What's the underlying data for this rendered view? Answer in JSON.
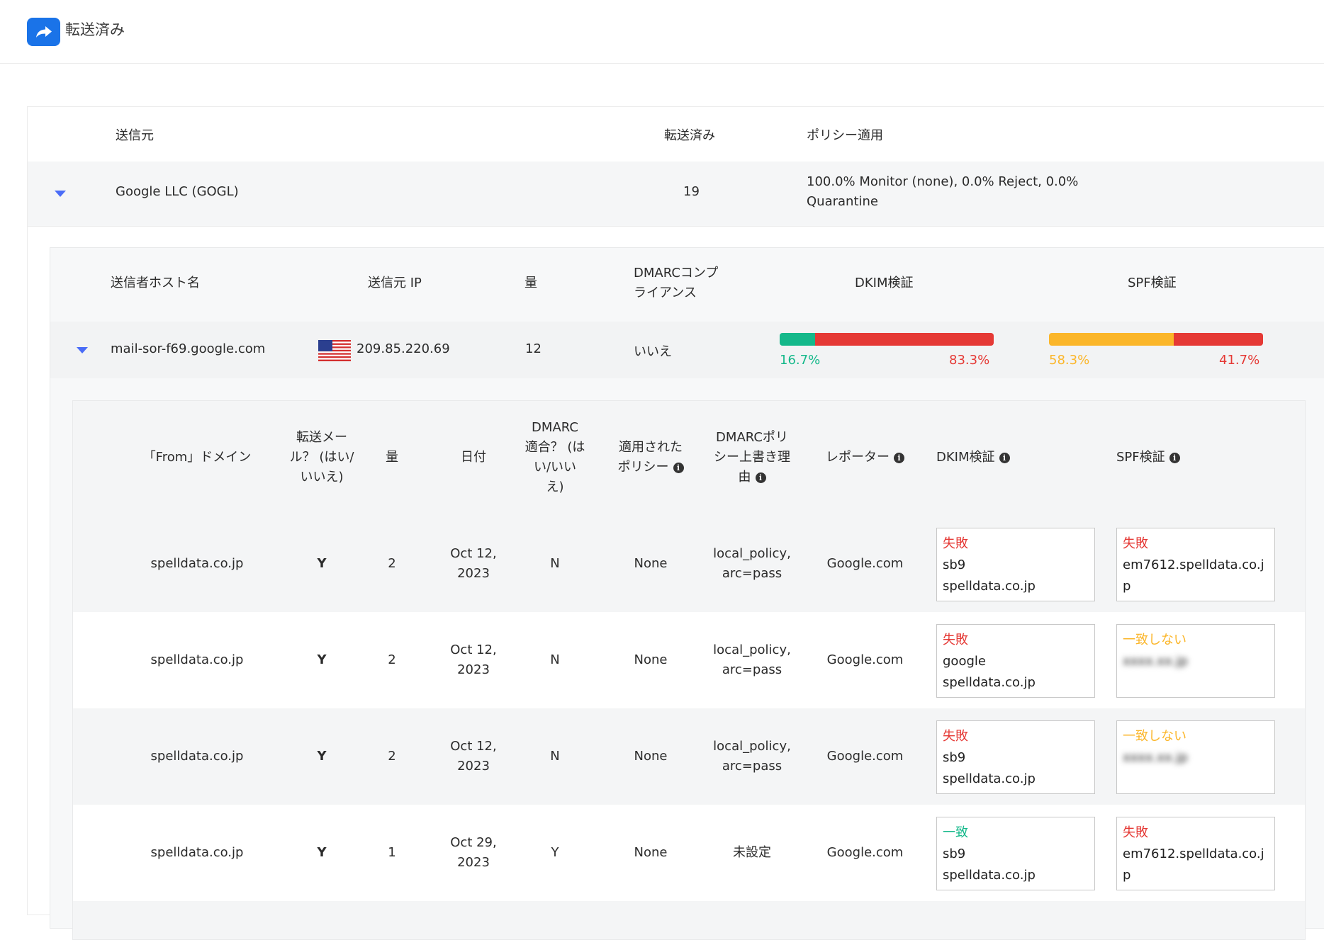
{
  "header": {
    "title": "転送済み",
    "icon": "forward-arrow-icon",
    "accent": "#1a73e8"
  },
  "table1": {
    "columns": {
      "source": "送信元",
      "forwarded": "転送済み",
      "policy": "ポリシー適用"
    },
    "row": {
      "source": "Google LLC (GOGL)",
      "forwarded": "19",
      "policy_line1": "100.0% Monitor (none), 0.0% Reject, 0.0%",
      "policy_line2": "Quarantine"
    }
  },
  "table2": {
    "columns": {
      "host": "送信者ホスト名",
      "ip": "送信元 IP",
      "volume": "量",
      "dmarc_line1": "DMARCコンプ",
      "dmarc_line2": "ライアンス",
      "dkim": "DKIM検証",
      "spf": "SPF検証"
    },
    "row": {
      "host": "mail-sor-f69.google.com",
      "ip": "209.85.220.69",
      "flag": "us-flag-icon",
      "volume": "12",
      "dmarc": "いいえ",
      "dkim": {
        "pass_pct": 16.7,
        "fail_pct": 83.3,
        "pass_label": "16.7%",
        "fail_label": "83.3%",
        "pass_color": "#14b88a",
        "fail_color": "#e53935"
      },
      "spf": {
        "pass_pct": 58.3,
        "fail_pct": 41.7,
        "pass_label": "58.3%",
        "fail_label": "41.7%",
        "pass_color": "#fbb62a",
        "fail_color": "#e53935"
      }
    }
  },
  "table3": {
    "columns": {
      "from_domain": "「From」ドメイン",
      "fwd_1": "転送メー",
      "fwd_2": "ル？ (はい/",
      "fwd_3": "いいえ)",
      "volume": "量",
      "date": "日付",
      "dmarc_1": "DMARC",
      "dmarc_2": "適合？ (は",
      "dmarc_3": "い/いい",
      "dmarc_4": "え)",
      "policy_1": "適用された",
      "policy_2": "ポリシー",
      "override_1": "DMARCポリ",
      "override_2": "シー上書き理",
      "override_3": "由",
      "reporter": "レポーター",
      "dkim": "DKIM検証",
      "spf": "SPF検証"
    },
    "rows": [
      {
        "domain": "spelldata.co.jp",
        "forwarded": "Y",
        "volume": "2",
        "date_1": "Oct 12,",
        "date_2": "2023",
        "dmarc": "N",
        "policy": "None",
        "override_1": "local_policy,",
        "override_2": "arc=pass",
        "reporter": "Google.com",
        "dkim_status": "失敗",
        "dkim_color": "#e53935",
        "dkim_d1": "sb9",
        "dkim_d2": "spelldata.co.jp",
        "spf_status": "失敗",
        "spf_color": "#e53935",
        "spf_d1": "em7612.spelldata.co.j",
        "spf_d2": "p"
      },
      {
        "domain": "spelldata.co.jp",
        "forwarded": "Y",
        "volume": "2",
        "date_1": "Oct 12,",
        "date_2": "2023",
        "dmarc": "N",
        "policy": "None",
        "override_1": "local_policy,",
        "override_2": "arc=pass",
        "reporter": "Google.com",
        "dkim_status": "失敗",
        "dkim_color": "#e53935",
        "dkim_d1": "google",
        "dkim_d2": "spelldata.co.jp",
        "spf_status": "一致しない",
        "spf_color": "#fbb62a",
        "spf_d1": "xxxx.xx.jp",
        "spf_d2": ""
      },
      {
        "domain": "spelldata.co.jp",
        "forwarded": "Y",
        "volume": "2",
        "date_1": "Oct 12,",
        "date_2": "2023",
        "dmarc": "N",
        "policy": "None",
        "override_1": "local_policy,",
        "override_2": "arc=pass",
        "reporter": "Google.com",
        "dkim_status": "失敗",
        "dkim_color": "#e53935",
        "dkim_d1": "sb9",
        "dkim_d2": "spelldata.co.jp",
        "spf_status": "一致しない",
        "spf_color": "#fbb62a",
        "spf_d1": "xxxx.xx.jp",
        "spf_d2": ""
      },
      {
        "domain": "spelldata.co.jp",
        "forwarded": "Y",
        "volume": "1",
        "date_1": "Oct 29,",
        "date_2": "2023",
        "dmarc": "Y",
        "policy": "None",
        "override_1": "未設定",
        "override_2": "",
        "reporter": "Google.com",
        "dkim_status": "一致",
        "dkim_color": "#14b88a",
        "dkim_d1": "sb9",
        "dkim_d2": "spelldata.co.jp",
        "spf_status": "失敗",
        "spf_color": "#e53935",
        "spf_d1": "em7612.spelldata.co.j",
        "spf_d2": "p"
      }
    ]
  }
}
